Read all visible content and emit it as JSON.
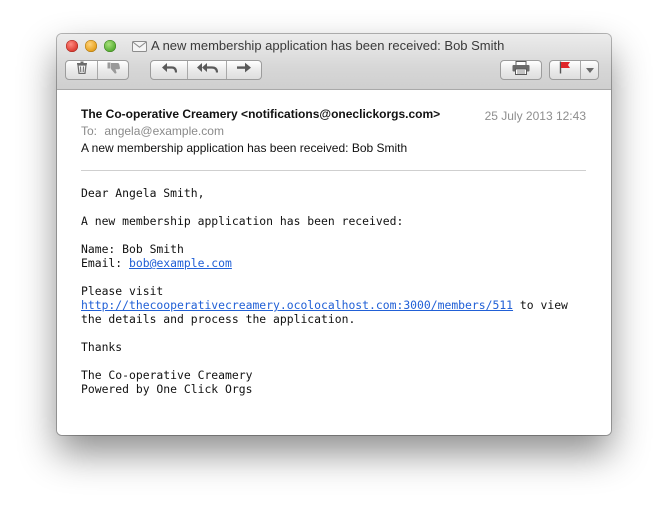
{
  "window": {
    "title": "A new membership application has been received: Bob Smith"
  },
  "toolbar": {
    "buttons": [
      {
        "name": "delete",
        "icon": "trash-icon"
      },
      {
        "name": "junk",
        "icon": "thumbs-down-icon"
      },
      {
        "name": "reply",
        "icon": "reply-icon"
      },
      {
        "name": "reply-all",
        "icon": "reply-all-icon"
      },
      {
        "name": "forward",
        "icon": "forward-icon"
      },
      {
        "name": "print",
        "icon": "printer-icon"
      },
      {
        "name": "flag",
        "icon": "flag-icon",
        "color": "#e0252a"
      }
    ]
  },
  "message": {
    "from": "The Co-operative Creamery <notifications@oneclickorgs.com>",
    "date": "25 July 2013 12:43",
    "to_label": "To:",
    "to": "angela@example.com",
    "subject": "A new membership application has been received: Bob Smith",
    "greeting": "Dear Angela Smith,",
    "intro": "A new membership application has been received:",
    "name_line": "Name: Bob Smith",
    "email_label": "Email:",
    "email_link": "bob@example.com",
    "visit_text": "Please visit",
    "visit_link": "http://thecooperativecreamery.ocolocalhost.com:3000/members/511",
    "visit_after": " to view",
    "visit_tail": "the details and process the application.",
    "thanks": "Thanks",
    "sign_org": "The Co-operative Creamery",
    "sign_powered": "Powered by One Click Orgs"
  },
  "colors": {
    "link": "#2160d6",
    "flag": "#e0252a"
  }
}
